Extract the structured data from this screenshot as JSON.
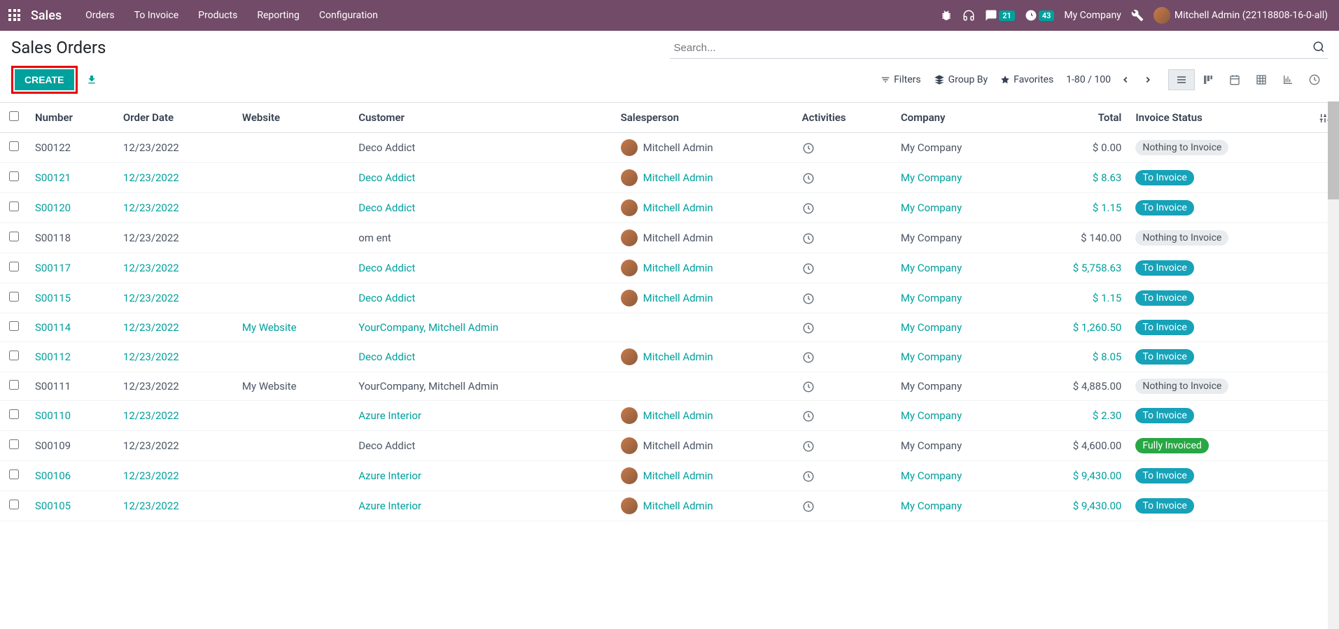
{
  "navbar": {
    "brand": "Sales",
    "menu": [
      {
        "label": "Orders"
      },
      {
        "label": "To Invoice"
      },
      {
        "label": "Products"
      },
      {
        "label": "Reporting"
      },
      {
        "label": "Configuration"
      }
    ],
    "chat_badge": "21",
    "clock_badge": "43",
    "company": "My Company",
    "user": "Mitchell Admin (22118808-16-0-all)"
  },
  "control": {
    "title": "Sales Orders",
    "create": "Create",
    "search_placeholder": "Search...",
    "filters": "Filters",
    "group_by": "Group By",
    "favorites": "Favorites",
    "pager": "1-80 / 100"
  },
  "columns": {
    "number": "Number",
    "order_date": "Order Date",
    "website": "Website",
    "customer": "Customer",
    "salesperson": "Salesperson",
    "activities": "Activities",
    "company": "Company",
    "total": "Total",
    "invoice_status": "Invoice Status"
  },
  "rows": [
    {
      "number": "S00122",
      "date": "12/23/2022",
      "website": "",
      "customer": "Deco Addict",
      "salesperson": "Mitchell Admin",
      "has_avatar": true,
      "company": "My Company",
      "total": "$ 0.00",
      "status": "Nothing to Invoice",
      "status_class": "status-nothing",
      "muted": true
    },
    {
      "number": "S00121",
      "date": "12/23/2022",
      "website": "",
      "customer": "Deco Addict",
      "salesperson": "Mitchell Admin",
      "has_avatar": true,
      "company": "My Company",
      "total": "$ 8.63",
      "status": "To Invoice",
      "status_class": "status-toinvoice",
      "muted": false
    },
    {
      "number": "S00120",
      "date": "12/23/2022",
      "website": "",
      "customer": "Deco Addict",
      "salesperson": "Mitchell Admin",
      "has_avatar": true,
      "company": "My Company",
      "total": "$ 1.15",
      "status": "To Invoice",
      "status_class": "status-toinvoice",
      "muted": false
    },
    {
      "number": "S00118",
      "date": "12/23/2022",
      "website": "",
      "customer": "om ent",
      "salesperson": "Mitchell Admin",
      "has_avatar": true,
      "company": "My Company",
      "total": "$ 140.00",
      "status": "Nothing to Invoice",
      "status_class": "status-nothing",
      "muted": true
    },
    {
      "number": "S00117",
      "date": "12/23/2022",
      "website": "",
      "customer": "Deco Addict",
      "salesperson": "Mitchell Admin",
      "has_avatar": true,
      "company": "My Company",
      "total": "$ 5,758.63",
      "status": "To Invoice",
      "status_class": "status-toinvoice",
      "muted": false
    },
    {
      "number": "S00115",
      "date": "12/23/2022",
      "website": "",
      "customer": "Deco Addict",
      "salesperson": "Mitchell Admin",
      "has_avatar": true,
      "company": "My Company",
      "total": "$ 1.15",
      "status": "To Invoice",
      "status_class": "status-toinvoice",
      "muted": false
    },
    {
      "number": "S00114",
      "date": "12/23/2022",
      "website": "My Website",
      "customer": "YourCompany, Mitchell Admin",
      "salesperson": "",
      "has_avatar": false,
      "company": "My Company",
      "total": "$ 1,260.50",
      "status": "To Invoice",
      "status_class": "status-toinvoice",
      "muted": false
    },
    {
      "number": "S00112",
      "date": "12/23/2022",
      "website": "",
      "customer": "Deco Addict",
      "salesperson": "Mitchell Admin",
      "has_avatar": true,
      "company": "My Company",
      "total": "$ 8.05",
      "status": "To Invoice",
      "status_class": "status-toinvoice",
      "muted": false
    },
    {
      "number": "S00111",
      "date": "12/23/2022",
      "website": "My Website",
      "customer": "YourCompany, Mitchell Admin",
      "salesperson": "",
      "has_avatar": false,
      "company": "My Company",
      "total": "$ 4,885.00",
      "status": "Nothing to Invoice",
      "status_class": "status-nothing",
      "muted": true
    },
    {
      "number": "S00110",
      "date": "12/23/2022",
      "website": "",
      "customer": "Azure Interior",
      "salesperson": "Mitchell Admin",
      "has_avatar": true,
      "company": "My Company",
      "total": "$ 2.30",
      "status": "To Invoice",
      "status_class": "status-toinvoice",
      "muted": false
    },
    {
      "number": "S00109",
      "date": "12/23/2022",
      "website": "",
      "customer": "Deco Addict",
      "salesperson": "Mitchell Admin",
      "has_avatar": true,
      "company": "My Company",
      "total": "$ 4,600.00",
      "status": "Fully Invoiced",
      "status_class": "status-fully",
      "muted": true
    },
    {
      "number": "S00106",
      "date": "12/23/2022",
      "website": "",
      "customer": "Azure Interior",
      "salesperson": "Mitchell Admin",
      "has_avatar": true,
      "company": "My Company",
      "total": "$ 9,430.00",
      "status": "To Invoice",
      "status_class": "status-toinvoice",
      "muted": false
    },
    {
      "number": "S00105",
      "date": "12/23/2022",
      "website": "",
      "customer": "Azure Interior",
      "salesperson": "Mitchell Admin",
      "has_avatar": true,
      "company": "My Company",
      "total": "$ 9,430.00",
      "status": "To Invoice",
      "status_class": "status-toinvoice",
      "muted": false
    }
  ]
}
